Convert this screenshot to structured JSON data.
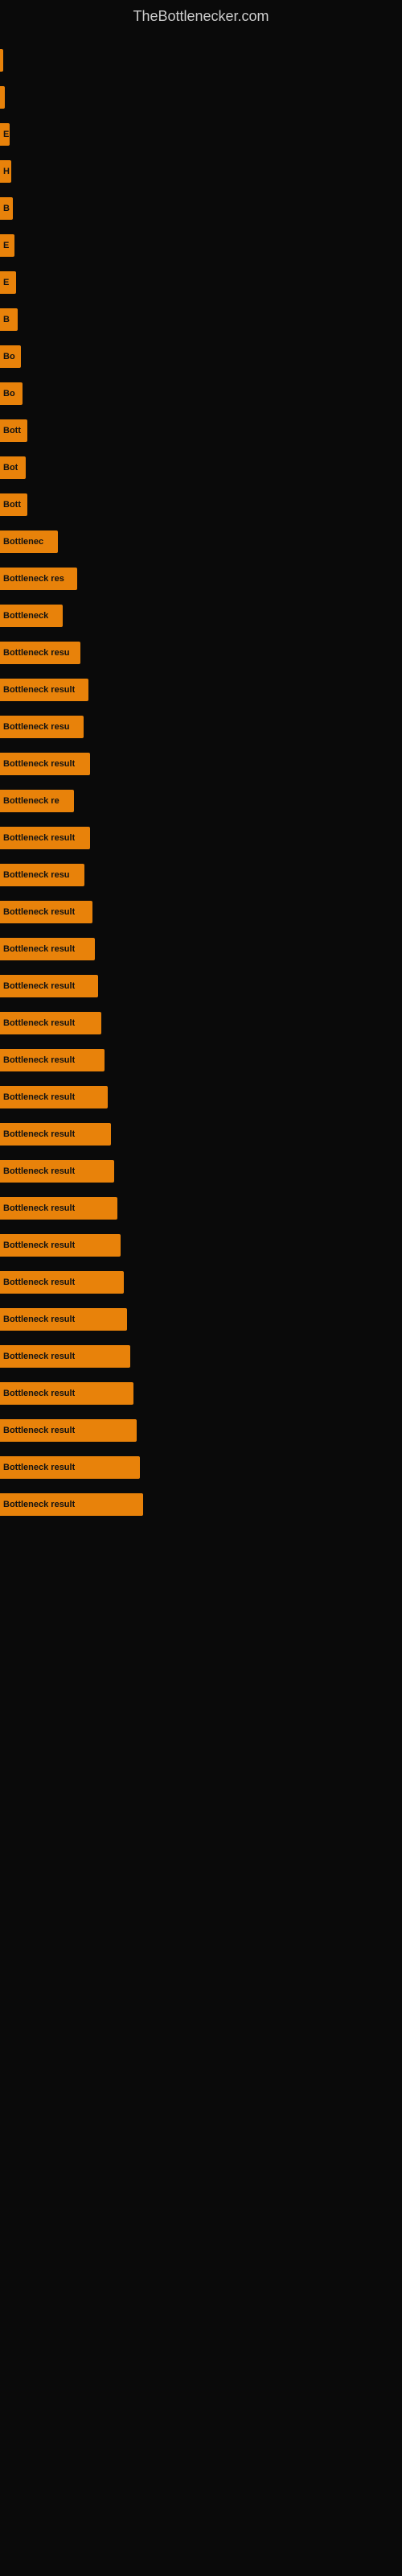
{
  "site": {
    "title": "TheBottlenecker.com"
  },
  "bars": [
    {
      "label": "",
      "width": 4
    },
    {
      "label": "",
      "width": 6
    },
    {
      "label": "E",
      "width": 12
    },
    {
      "label": "H",
      "width": 14
    },
    {
      "label": "B",
      "width": 16
    },
    {
      "label": "E",
      "width": 18
    },
    {
      "label": "E",
      "width": 20
    },
    {
      "label": "B",
      "width": 22
    },
    {
      "label": "Bo",
      "width": 26
    },
    {
      "label": "Bo",
      "width": 28
    },
    {
      "label": "Bott",
      "width": 34
    },
    {
      "label": "Bot",
      "width": 32
    },
    {
      "label": "Bott",
      "width": 34
    },
    {
      "label": "Bottlenec",
      "width": 72
    },
    {
      "label": "Bottleneck res",
      "width": 96
    },
    {
      "label": "Bottleneck",
      "width": 78
    },
    {
      "label": "Bottleneck resu",
      "width": 100
    },
    {
      "label": "Bottleneck result",
      "width": 110
    },
    {
      "label": "Bottleneck resu",
      "width": 104
    },
    {
      "label": "Bottleneck result",
      "width": 112
    },
    {
      "label": "Bottleneck re",
      "width": 92
    },
    {
      "label": "Bottleneck result",
      "width": 112
    },
    {
      "label": "Bottleneck resu",
      "width": 105
    },
    {
      "label": "Bottleneck result",
      "width": 115
    },
    {
      "label": "Bottleneck result",
      "width": 118
    },
    {
      "label": "Bottleneck result",
      "width": 122
    },
    {
      "label": "Bottleneck result",
      "width": 126
    },
    {
      "label": "Bottleneck result",
      "width": 130
    },
    {
      "label": "Bottleneck result",
      "width": 134
    },
    {
      "label": "Bottleneck result",
      "width": 138
    },
    {
      "label": "Bottleneck result",
      "width": 142
    },
    {
      "label": "Bottleneck result",
      "width": 146
    },
    {
      "label": "Bottleneck result",
      "width": 150
    },
    {
      "label": "Bottleneck result",
      "width": 154
    },
    {
      "label": "Bottleneck result",
      "width": 158
    },
    {
      "label": "Bottleneck result",
      "width": 162
    },
    {
      "label": "Bottleneck result",
      "width": 166
    },
    {
      "label": "Bottleneck result",
      "width": 170
    },
    {
      "label": "Bottleneck result",
      "width": 174
    },
    {
      "label": "Bottleneck result",
      "width": 178
    }
  ]
}
